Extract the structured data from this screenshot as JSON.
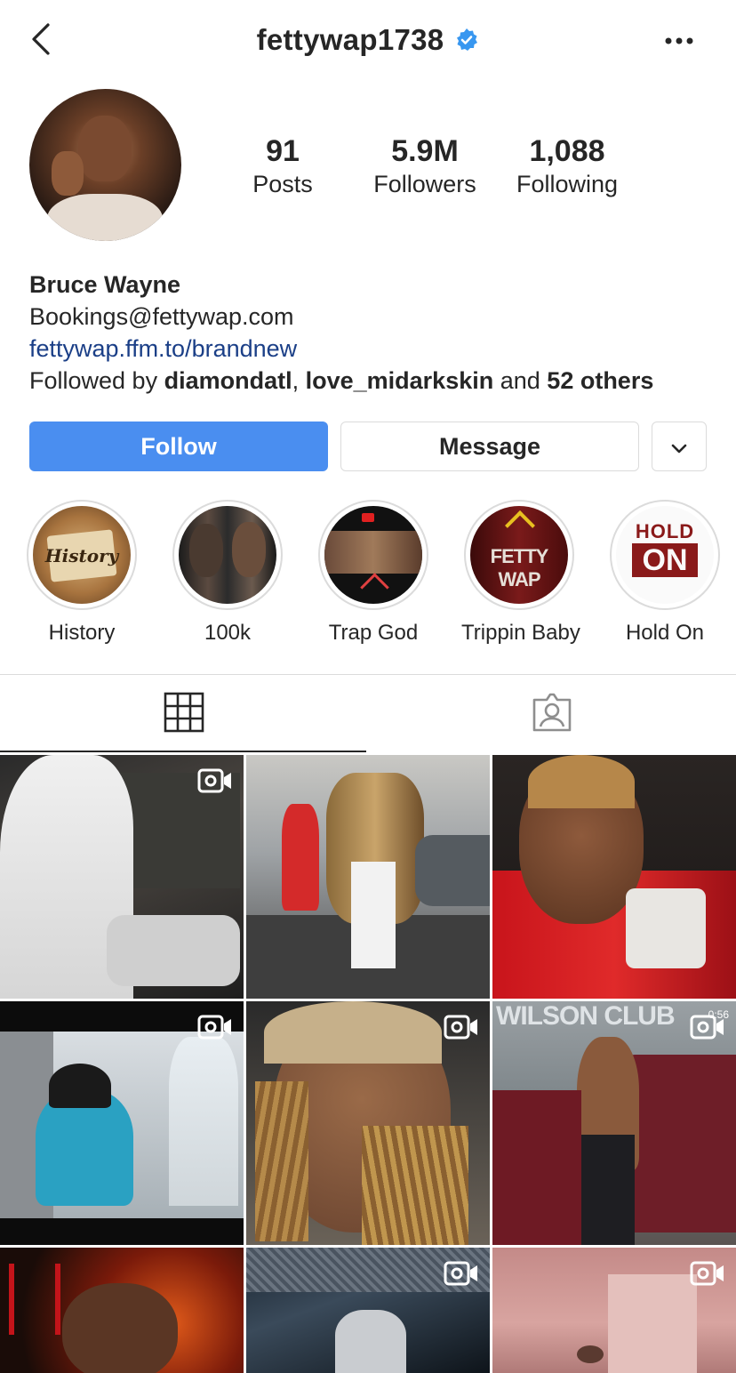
{
  "header": {
    "username": "fettywap1738"
  },
  "profile": {
    "stats": [
      {
        "value": "91",
        "label": "Posts"
      },
      {
        "value": "5.9M",
        "label": "Followers"
      },
      {
        "value": "1,088",
        "label": "Following"
      }
    ],
    "name": "Bruce Wayne",
    "email": "Bookings@fettywap.com",
    "link": "fettywap.ffm.to/brandnew",
    "followed_prefix": "Followed by ",
    "followed_user1": "diamondatl",
    "followed_sep": ", ",
    "followed_user2": "love_midarkskin",
    "followed_and": " and ",
    "followed_others": "52 others"
  },
  "actions": {
    "follow_label": "Follow",
    "message_label": "Message"
  },
  "highlights": [
    {
      "label": "History"
    },
    {
      "label": "100k"
    },
    {
      "label": "Trap God"
    },
    {
      "label": "Trippin Baby"
    },
    {
      "label": "Hold On"
    }
  ],
  "highlight_art": {
    "history": "History",
    "trippin": "FETTY WAP",
    "holdon_top": "HOLD",
    "holdon_bottom": "ON"
  },
  "grid_overlays": {
    "wilson": "WILSON CLUB",
    "duration": "0:56"
  },
  "colors": {
    "follow_button": "#4a8ef0",
    "link": "#1b3f87",
    "verified": "#3897f0",
    "border": "#dbdbdb"
  },
  "icons": [
    "back-icon",
    "verified-icon",
    "more-icon",
    "chevron-down-icon",
    "grid-icon",
    "tagged-icon",
    "video-icon"
  ]
}
